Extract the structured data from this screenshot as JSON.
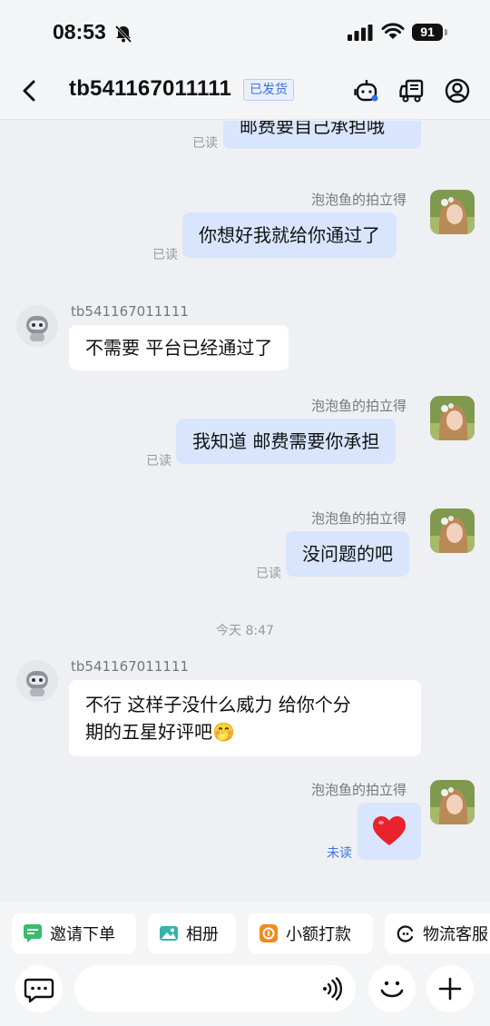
{
  "status_bar": {
    "time": "08:53",
    "battery": "91"
  },
  "header": {
    "title": "tb541167011111",
    "badge": "已发货"
  },
  "messages": [
    {
      "text": "邮费要自己承担哦",
      "status": "已读"
    },
    {
      "sender": "泡泡鱼的拍立得",
      "text": "你想好我就给你通过了",
      "status": "已读"
    },
    {
      "sender": "tb541167011111",
      "text": "不需要 平台已经通过了"
    },
    {
      "sender": "泡泡鱼的拍立得",
      "text": "我知道 邮费需要你承担",
      "status": "已读"
    },
    {
      "sender": "泡泡鱼的拍立得",
      "text": "没问题的吧",
      "status": "已读"
    },
    {
      "timestamp": "今天 8:47"
    },
    {
      "sender": "tb541167011111",
      "line1": "不行 这样子没什么威力  给你个分",
      "line2": "期的五星好评吧",
      "emoji": "🤭"
    },
    {
      "sender": "泡泡鱼的拍立得",
      "emoji": "❤️",
      "status": "未读"
    }
  ],
  "quick_actions": [
    "邀请下单",
    "相册",
    "小额打款",
    "物流客服"
  ],
  "icons": {
    "back": "chevron-left-icon",
    "robot": "robot-icon",
    "truck": "truck-icon",
    "profile": "profile-icon",
    "chat": "chat-bubble-icon",
    "voice": "voice-icon",
    "emoji": "emoji-icon",
    "plus": "plus-icon"
  }
}
